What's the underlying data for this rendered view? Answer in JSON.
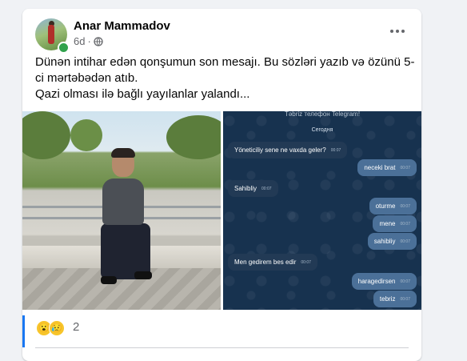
{
  "post": {
    "author": "Anar Mammadov",
    "time": "6d",
    "audience_icon": "globe-icon",
    "text_lines": [
      "Dünən intihar edən qonşumun son mesajı. Bu sözləri yazıb və özünü 5-",
      "ci mərtəbədən atıb.",
      "Qazi olması ilə bağlı yayılanlar yalandı..."
    ]
  },
  "chat": {
    "header": "Təbriz телефон Telegram!",
    "date": "Сегодня",
    "messages": [
      {
        "dir": "in",
        "text": "Yöneticiliy sene ne vaxda geler?",
        "time": "00:07"
      },
      {
        "dir": "out",
        "text": "neceki brat",
        "time": "00:07"
      },
      {
        "dir": "in",
        "text": "Sahibliy",
        "time": "00:07"
      },
      {
        "dir": "out",
        "text": "oturme",
        "time": "00:07"
      },
      {
        "dir": "out",
        "text": "mene",
        "time": "00:07"
      },
      {
        "dir": "out",
        "text": "sahibliy",
        "time": "00:07"
      },
      {
        "dir": "in",
        "text": "Men gedirem bes edir",
        "time": "00:07"
      },
      {
        "dir": "out",
        "text": "haragedirsen",
        "time": "00:07"
      },
      {
        "dir": "out",
        "text": "tebriz",
        "time": "00:07"
      }
    ]
  },
  "reactions": {
    "icons": [
      "wow-emoji-icon",
      "sad-emoji-icon"
    ],
    "glyphs": [
      "😮",
      "😥"
    ],
    "count": "2"
  }
}
